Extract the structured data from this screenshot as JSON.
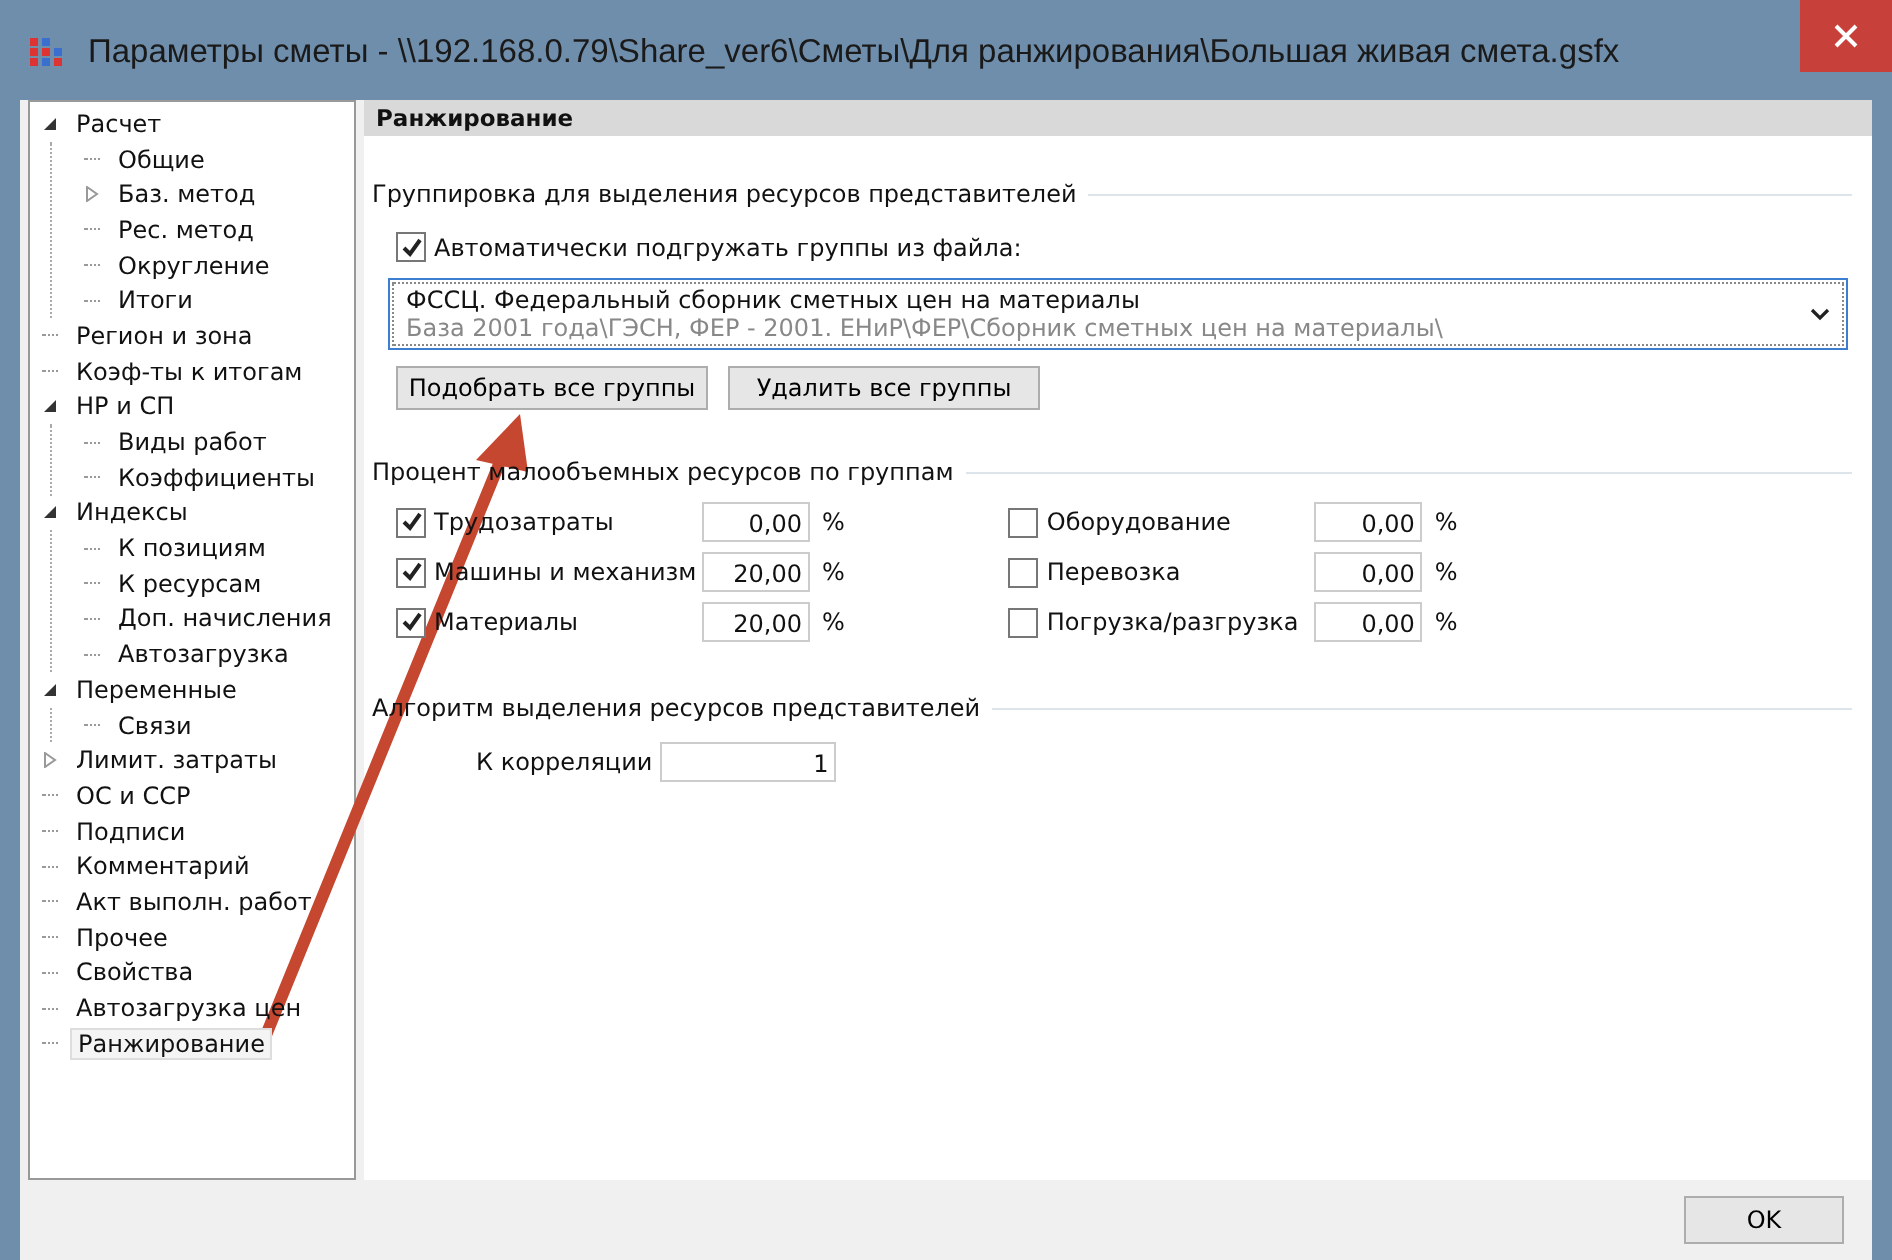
{
  "window": {
    "title": "Параметры сметы - \\\\192.168.0.79\\Share_ver6\\Сметы\\Для ранжирования\\Большая живая смета.gsfx"
  },
  "tree": [
    {
      "label": "Расчет",
      "expanded": true,
      "selected": false,
      "children": [
        {
          "label": "Общие",
          "selected": false
        },
        {
          "label": "Баз. метод",
          "expanded": false,
          "selected": false
        },
        {
          "label": "Рес. метод",
          "selected": false
        },
        {
          "label": "Округление",
          "selected": false
        },
        {
          "label": "Итоги",
          "selected": false
        }
      ]
    },
    {
      "label": "Регион и зона",
      "selected": false
    },
    {
      "label": "Коэф-ты к итогам",
      "selected": false
    },
    {
      "label": "НР и СП",
      "expanded": true,
      "selected": false,
      "children": [
        {
          "label": "Виды работ",
          "selected": false
        },
        {
          "label": "Коэффициенты",
          "selected": false
        }
      ]
    },
    {
      "label": "Индексы",
      "expanded": true,
      "selected": false,
      "children": [
        {
          "label": "К позициям",
          "selected": false
        },
        {
          "label": "К ресурсам",
          "selected": false
        },
        {
          "label": "Доп. начисления",
          "selected": false
        },
        {
          "label": "Автозагрузка",
          "selected": false
        }
      ]
    },
    {
      "label": "Переменные",
      "expanded": true,
      "selected": false,
      "children": [
        {
          "label": "Связи",
          "selected": false
        }
      ]
    },
    {
      "label": "Лимит. затраты",
      "expanded": false,
      "selected": false
    },
    {
      "label": "ОС и ССР",
      "selected": false
    },
    {
      "label": "Подписи",
      "selected": false
    },
    {
      "label": "Комментарий",
      "selected": false
    },
    {
      "label": "Акт выполн. работ",
      "selected": false
    },
    {
      "label": "Прочее",
      "selected": false
    },
    {
      "label": "Свойства",
      "selected": false
    },
    {
      "label": "Автозагрузка цен",
      "selected": false
    },
    {
      "label": "Ранжирование",
      "selected": true
    }
  ],
  "panel": {
    "title": "Ранжирование",
    "grouping": {
      "heading": "Группировка для выделения ресурсов представителей",
      "auto_load": {
        "label": "Автоматически подгружать группы из файла:",
        "checked": true
      },
      "file_select": {
        "title": "ФССЦ. Федеральный сборник сметных цен на материалы",
        "path": "База 2001 года\\ГЭСН, ФЕР - 2001. ЕНиР\\ФЕР\\Сборник сметных цен на материалы\\"
      },
      "buttons": [
        "Подобрать все группы",
        "Удалить все группы"
      ]
    },
    "percent": {
      "heading": "Процент малообъемных ресурсов по группам",
      "items": [
        {
          "label": "Трудозатраты",
          "checked": true,
          "value": "0,00",
          "unit": "%"
        },
        {
          "label": "Машины и механизм",
          "checked": true,
          "value": "20,00",
          "unit": "%"
        },
        {
          "label": "Материалы",
          "checked": true,
          "value": "20,00",
          "unit": "%"
        },
        {
          "label": "Оборудование",
          "checked": false,
          "value": "0,00",
          "unit": "%"
        },
        {
          "label": "Перевозка",
          "checked": false,
          "value": "0,00",
          "unit": "%"
        },
        {
          "label": "Погрузка/разгрузка",
          "checked": false,
          "value": "0,00",
          "unit": "%"
        }
      ]
    },
    "algorithm": {
      "heading": "Алгоритм выделения ресурсов представителей",
      "correlation": {
        "label": "К корреляции",
        "value": "1"
      }
    }
  },
  "buttons": [
    "OK"
  ]
}
